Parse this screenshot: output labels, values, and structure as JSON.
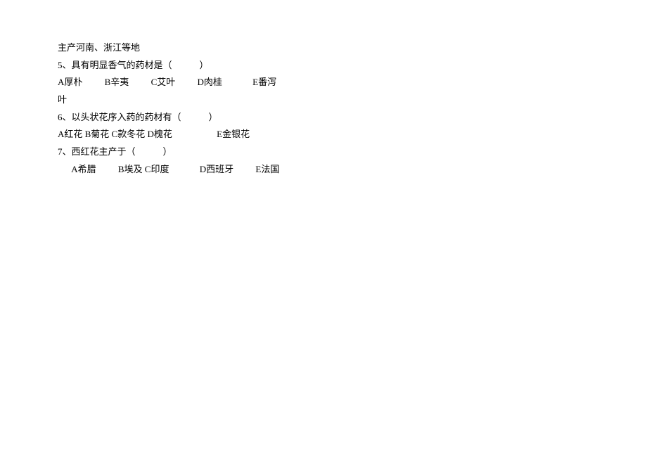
{
  "lines": {
    "l1": "主产河南、浙江等地",
    "l2": "5、具有明显香气的药材是（　　　）",
    "l3a": "A厚朴",
    "l3b": "B辛夷",
    "l3c": "C艾叶",
    "l3d": "D肉桂",
    "l3e": "E番泻",
    "l4": "叶",
    "l5": "6、以头状花序入药的药材有（　　　）",
    "l6a": "A红花 B菊花 C款冬花 D槐花",
    "l6e": "E金银花",
    "l7": "7、西红花主产于（　　　）",
    "l8a": "A希腊",
    "l8b": "B埃及 C印度",
    "l8d": "D西班牙",
    "l8e": "E法国"
  }
}
